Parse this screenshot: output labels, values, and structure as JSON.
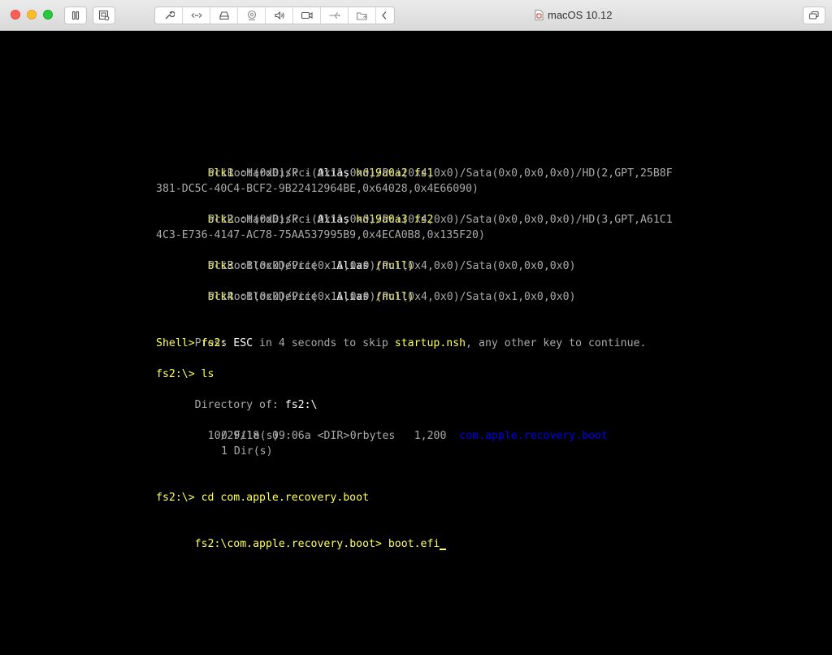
{
  "window": {
    "title": "macOS 10.12"
  },
  "terminal": {
    "blk1_label": "blk1",
    "blk1_type": " :HardDisk - ",
    "blk1_alias_word": "Alias",
    "blk1_alias": " hd19a0a2 fs1",
    "blk1_path1": "PciRoot(0x0)/Pci(0x11,0x0)/Pci(0x4,0x0)/Sata(0x0,0x0,0x0)/HD(2,GPT,25B8F",
    "blk1_path2": "381-DC5C-40C4-BCF2-9B22412964BE,0x64028,0x4E66090)",
    "blk2_label": "blk2",
    "blk2_type": " :HardDisk - ",
    "blk2_alias_word": "Alias",
    "blk2_alias": " hd19a0a3 fs2",
    "blk2_path1": "PciRoot(0x0)/Pci(0x11,0x0)/Pci(0x4,0x0)/Sata(0x0,0x0,0x0)/HD(3,GPT,A61C1",
    "blk2_path2": "4C3-E736-4147-AC78-75AA537995B9,0x4ECA0B8,0x135F20)",
    "blk3_label": "blk3",
    "blk3_type": " :BlockDevice - ",
    "blk3_alias_word": "Alias",
    "blk3_alias": " (null)",
    "blk3_path": "PciRoot(0x0)/Pci(0x11,0x0)/Pci(0x4,0x0)/Sata(0x0,0x0,0x0)",
    "blk4_label": "blk4",
    "blk4_type": " :BlockDevice - ",
    "blk4_alias_word": "Alias",
    "blk4_alias": " (null)",
    "blk4_path": "PciRoot(0x0)/Pci(0x11,0x0)/Pci(0x4,0x0)/Sata(0x1,0x0,0x0)",
    "press_1": "Press ",
    "press_esc": "ESC",
    "press_2": " in 4 seconds to skip ",
    "press_startup": "startup.nsh",
    "press_3": ", any other key to continue.",
    "shell_prompt": "Shell> fs2:",
    "ls_prompt": "fs2:\\> ls",
    "dir_of_label": "Directory of: ",
    "dir_of_value": "fs2:\\",
    "entry_date": "10/29/18  09:06a <DIR> r        1,200  ",
    "entry_name": "com.apple.recovery.boot",
    "files_summary": "0 File(s)           0 bytes",
    "dirs_summary": "1 Dir(s)",
    "cd_command": "fs2:\\> cd com.apple.recovery.boot",
    "boot_command": "fs2:\\com.apple.recovery.boot> boot.efi"
  },
  "colors": {
    "yellow": "#ffff55",
    "white": "#ffffff",
    "gray": "#aaaaaa",
    "blue": "#0000ee"
  }
}
